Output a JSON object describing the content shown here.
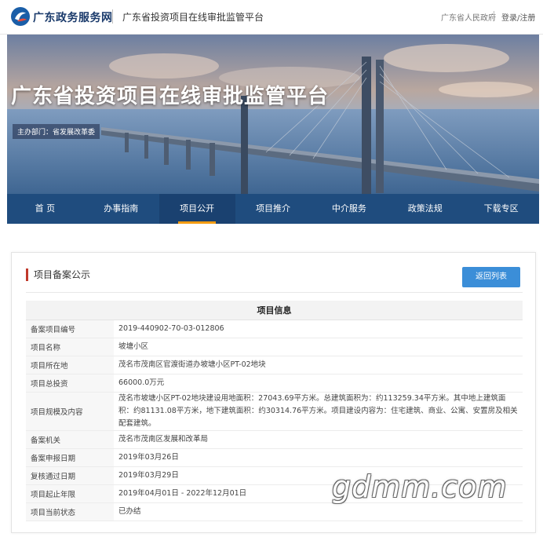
{
  "header": {
    "site_name": "广东政务服务网",
    "platform_name": "广东省投资项目在线审批监管平台",
    "gov_link": "广东省人民政府",
    "login_link": "登录/注册",
    "logo_icon": "guangdong-gov-logo-icon"
  },
  "banner": {
    "title": "广东省投资项目在线审批监管平台",
    "sponsor": "主办部门：省发展改革委",
    "carousel_index": 2,
    "carousel_count": 3
  },
  "nav": {
    "items": [
      {
        "label": "首 页"
      },
      {
        "label": "办事指南"
      },
      {
        "label": "项目公开"
      },
      {
        "label": "项目推介"
      },
      {
        "label": "中介服务"
      },
      {
        "label": "政策法规"
      },
      {
        "label": "下载专区"
      }
    ],
    "active_index": 2
  },
  "card": {
    "title": "项目备案公示",
    "back_label": "返回列表",
    "table_title": "项目信息",
    "rows": [
      {
        "label": "备案项目编号",
        "value": "2019-440902-70-03-012806"
      },
      {
        "label": "项目名称",
        "value": "坡塘小区"
      },
      {
        "label": "项目所在地",
        "value": "茂名市茂南区官渡街道办坡塘小区PT-02地块"
      },
      {
        "label": "项目总投资",
        "value": "66000.0万元"
      },
      {
        "label": "项目规模及内容",
        "value": "茂名市坡塘小区PT-02地块建设用地面积：27043.69平方米。总建筑面积为：约113259.34平方米。其中地上建筑面积：约81131.08平方米，地下建筑面积：约30314.76平方米。项目建设内容为：住宅建筑、商业、公寓、安置房及相关配套建筑。"
      },
      {
        "label": "备案机关",
        "value": "茂名市茂南区发展和改革局"
      },
      {
        "label": "备案申报日期",
        "value": "2019年03月26日"
      },
      {
        "label": "复核通过日期",
        "value": "2019年03月29日"
      },
      {
        "label": "项目起止年限",
        "value": "2019年04月01日 - 2022年12月01日"
      },
      {
        "label": "项目当前状态",
        "value": "已办结"
      }
    ]
  },
  "watermark": "gdmm.com",
  "colors": {
    "nav_bg": "#1f4c7e",
    "nav_active_underline": "#f39c12",
    "button_blue": "#3b8ed8",
    "title_bar": "#c0392b"
  }
}
